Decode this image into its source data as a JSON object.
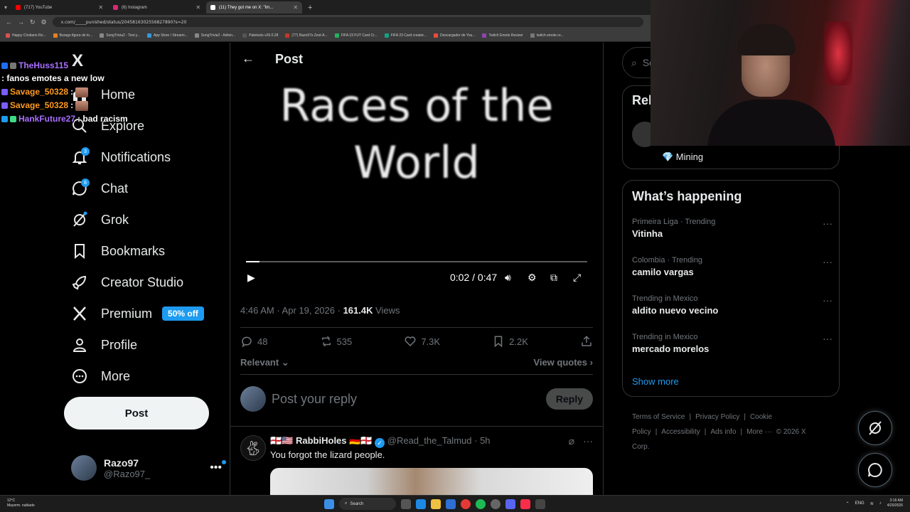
{
  "browser": {
    "tabs": [
      {
        "title": "(717) YouTube",
        "color": "#ff0000",
        "active": false
      },
      {
        "title": "(6) Instagram",
        "color": "#d62976",
        "active": false
      },
      {
        "title": "(11) They got me on X: \"Im...",
        "color": "#ffffff",
        "active": true
      }
    ],
    "url": "x.com/_____punished/status/2045816302556827890?s=20",
    "bookmarks": [
      "Happy Cristiano Ro...",
      "Burago figura de to...",
      "SongTrivia2 - Test y...",
      "App Store / Streami...",
      "SongTrivia2 - Adivin...",
      "Paletools v26.0.28",
      "(77) Razo97s Zest-A...",
      "FIFA 23 FUT Card Cr...",
      "FIFA 23 Card creator...",
      "Descargador de You...",
      "Twitch Emote Resizer",
      "twitch emote re..."
    ]
  },
  "chat_overlay": [
    {
      "user": "TheHuss115",
      "user_color": "#a970ff",
      "message": ": fanos emotes a new low"
    },
    {
      "user": "Savage_50328",
      "user_color": "#ff9a1f",
      "message": ":",
      "emote": true
    },
    {
      "user": "Savage_50328",
      "user_color": "#ff9a1f",
      "message": ":",
      "emote": true
    },
    {
      "user": "HankFuture27",
      "user_color": "#a970ff",
      "message": ": bad racism"
    }
  ],
  "sidebar": {
    "logo": "X",
    "items": [
      {
        "label": "Home",
        "icon": "home-icon"
      },
      {
        "label": "Explore",
        "icon": "search-icon"
      },
      {
        "label": "Notifications",
        "icon": "bell-icon",
        "badge": "3"
      },
      {
        "label": "Chat",
        "icon": "chat-icon",
        "badge": "8"
      },
      {
        "label": "Grok",
        "icon": "grok-icon"
      },
      {
        "label": "Bookmarks",
        "icon": "bookmark-icon"
      },
      {
        "label": "Creator Studio",
        "icon": "rocket-icon"
      },
      {
        "label": "Premium",
        "icon": "x-icon",
        "tag": "50% off"
      },
      {
        "label": "Profile",
        "icon": "person-icon"
      },
      {
        "label": "More",
        "icon": "more-circle-icon"
      }
    ],
    "post_button": "Post",
    "account": {
      "name": "Razo97",
      "handle": "@Razo97_"
    }
  },
  "main": {
    "header_title": "Post",
    "video": {
      "line1": "Races of the",
      "line2": "World",
      "time": "0:02 / 0:47",
      "progress": 0.04
    },
    "meta": {
      "time": "4:46 AM",
      "date": "Apr 19, 2026",
      "views_count": "161.4K",
      "views_label": "Views"
    },
    "actions": {
      "replies": "48",
      "reposts": "535",
      "likes": "7.3K",
      "bookmarks": "2.2K"
    },
    "sort_label": "Relevant",
    "view_quotes": "View quotes",
    "reply_placeholder": "Post your reply",
    "reply_button": "Reply",
    "reply_tweet": {
      "flags_before": "🏴󠁧󠁢󠁥󠁮󠁧󠁿🇺🇸",
      "name": "RabbiHoles",
      "flags_after": "🇩🇪🏴󠁧󠁢󠁥󠁮󠁧󠁿",
      "handle": "@Read_the_Talmud",
      "time": "5h",
      "text": "You forgot the lizard people."
    }
  },
  "right": {
    "search_placeholder": "Se",
    "relevant_title": "Rel",
    "relevant_user_label": "💎 Mining",
    "whats_happening_title": "What’s happening",
    "trends": [
      {
        "meta": "Primeira Liga · Trending",
        "name": "Vitinha"
      },
      {
        "meta": "Colombia · Trending",
        "name": "camilo vargas"
      },
      {
        "meta": "Trending in Mexico",
        "name": "aldito nuevo vecino"
      },
      {
        "meta": "Trending in Mexico",
        "name": "mercado morelos"
      }
    ],
    "show_more": "Show more",
    "footer_links": [
      "Terms of Service",
      "|",
      "Privacy Policy",
      "|",
      "Cookie Policy",
      "|",
      "Accessibility",
      "|",
      "Ads info",
      "|",
      "More ···",
      "© 2026 X Corp."
    ]
  },
  "taskbar": {
    "weather_temp": "12°C",
    "weather_desc": "Mayorm. nublado",
    "search_label": "Search",
    "lang": "ENG",
    "time": "3:16 AM",
    "date": "4/20/2026"
  },
  "colors": {
    "accent": "#1d9bf0",
    "background": "#000000",
    "muted": "#71767b"
  }
}
